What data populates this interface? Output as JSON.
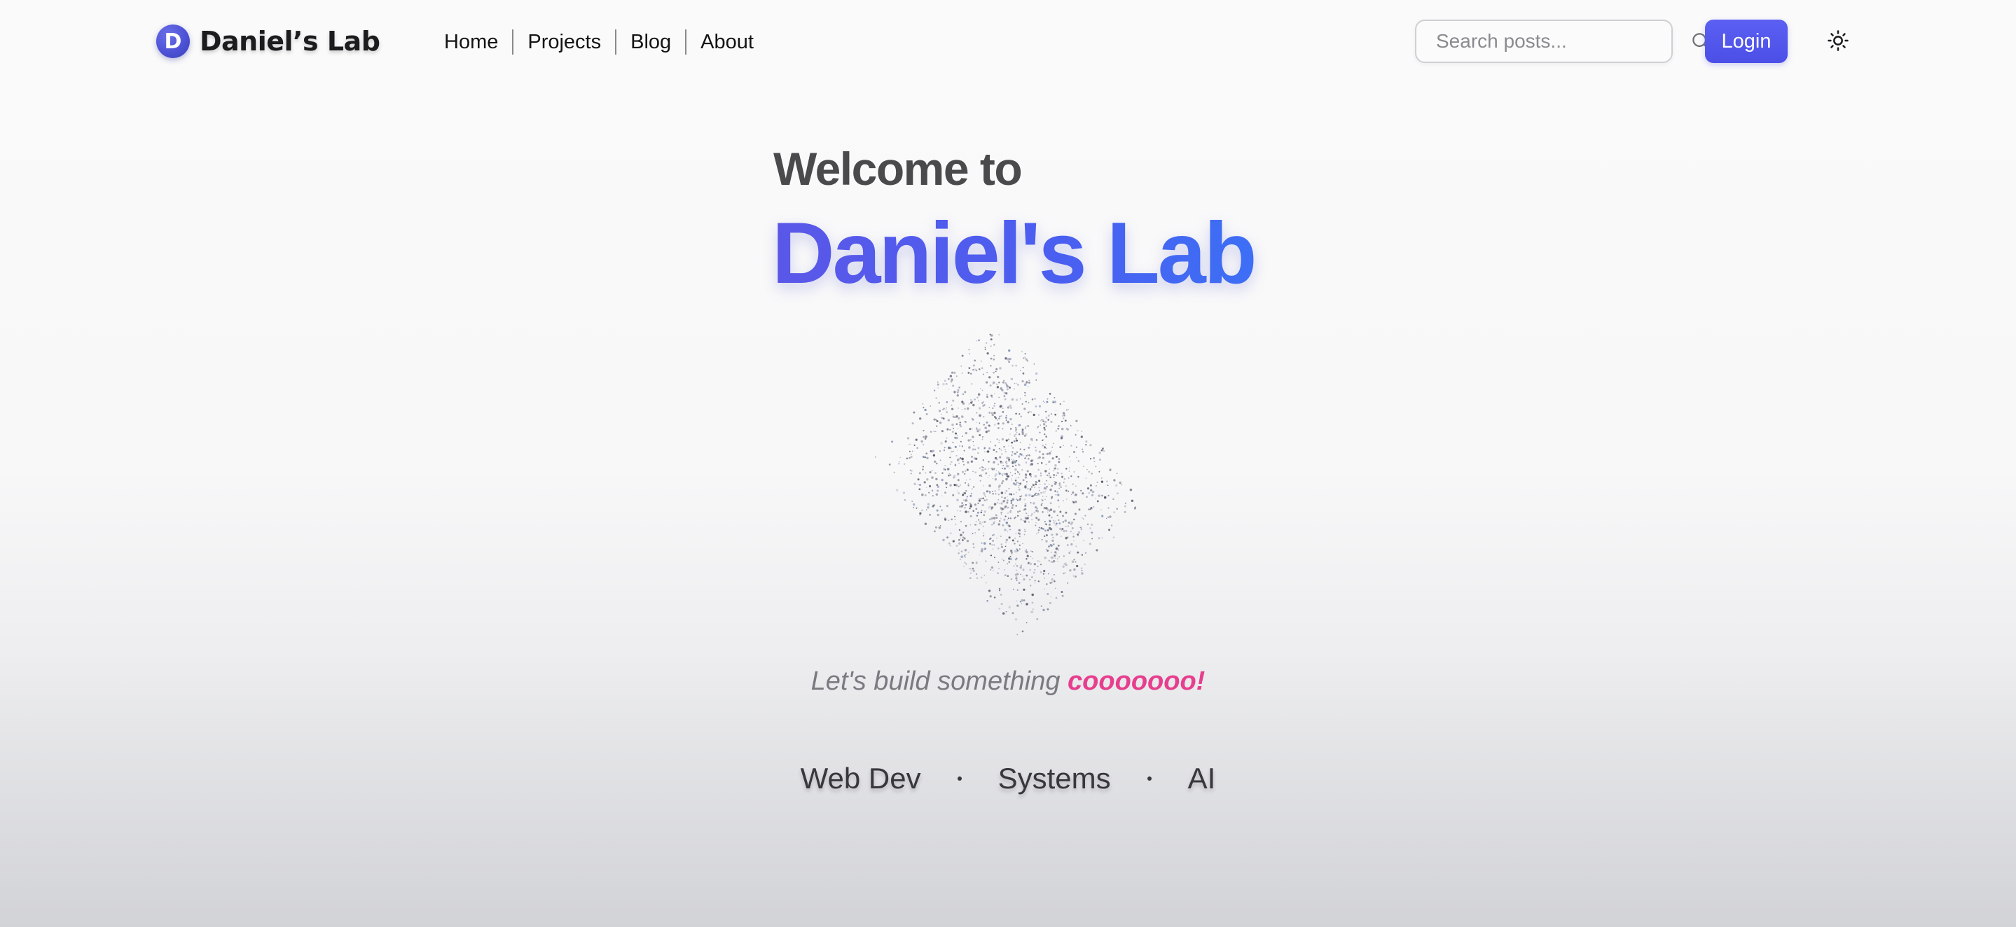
{
  "header": {
    "brand": {
      "logo_letter": "D",
      "name": "Daniel’s Lab"
    },
    "nav": [
      {
        "label": "Home"
      },
      {
        "label": "Projects"
      },
      {
        "label": "Blog"
      },
      {
        "label": "About"
      }
    ],
    "search": {
      "placeholder": "Search posts...",
      "icon": "search-icon"
    },
    "login_label": "Login",
    "theme_toggle_icon": "sun-icon"
  },
  "hero": {
    "welcome": "Welcome to",
    "title": "Daniel's Lab",
    "tagline_prefix": "Let's build something ",
    "tagline_accent": "cooooooo!",
    "topics": [
      "Web Dev",
      "Systems",
      "AI"
    ]
  },
  "colors": {
    "accent": "#4f58ea",
    "login_button": "#5356ed",
    "tagline_accent": "#e63f8e",
    "heading": "#4a4a4c"
  }
}
